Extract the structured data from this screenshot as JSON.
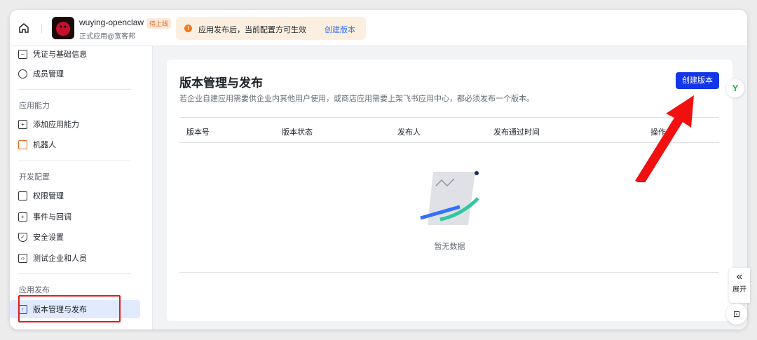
{
  "header": {
    "app_name": "wuying-openclaw",
    "status_badge": "待上线",
    "app_sub": "正式应用@宽客邦",
    "notice_text": "应用发布后，当前配置方可生效",
    "notice_link": "创建版本"
  },
  "sidebar": {
    "items_top": [
      {
        "label": "凭证与基础信息"
      },
      {
        "label": "成员管理"
      }
    ],
    "groups": [
      {
        "title": "应用能力",
        "items": [
          {
            "label": "添加应用能力"
          },
          {
            "label": "机器人"
          }
        ]
      },
      {
        "title": "开发配置",
        "items": [
          {
            "label": "权限管理"
          },
          {
            "label": "事件与回调"
          },
          {
            "label": "安全设置"
          },
          {
            "label": "测试企业和人员"
          }
        ]
      },
      {
        "title": "应用发布",
        "items": [
          {
            "label": "版本管理与发布"
          }
        ]
      }
    ]
  },
  "main": {
    "title": "版本管理与发布",
    "description": "若企业自建应用需要供企业内其他用户使用，或商店应用需要上架飞书应用中心，都必须发布一个版本。",
    "create_button": "创建版本",
    "columns": [
      "版本号",
      "版本状态",
      "发布人",
      "发布通过时间",
      "操作"
    ],
    "empty_text": "暂无数据"
  },
  "floating": {
    "expand_label": "展开",
    "brand_letter": "Y"
  }
}
